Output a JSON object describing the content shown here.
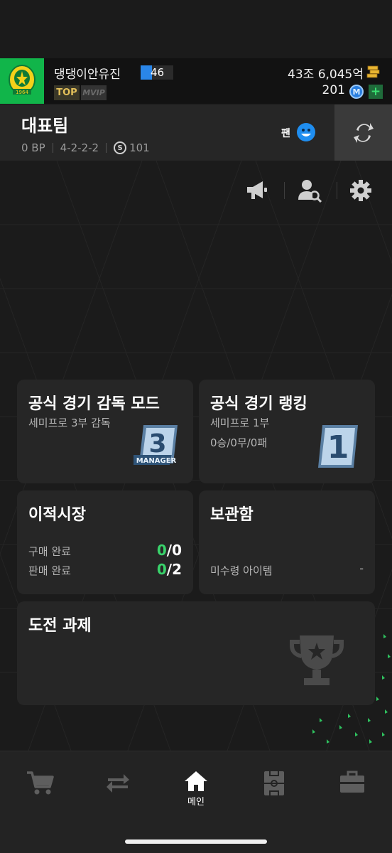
{
  "profile": {
    "nickname": "댕댕이안유진",
    "level": "46",
    "badge_top": "TOP",
    "badge_vip": "MVIP",
    "gold_amount": "43조 6,045억",
    "m_amount": "201",
    "m_icon_letter": "M",
    "plus_label": "+"
  },
  "team": {
    "title": "대표팀",
    "bp": "0 BP",
    "formation": "4-2-2-2",
    "s_icon_letter": "S",
    "score": "101",
    "fan_label": "팬"
  },
  "cards": {
    "manager_mode": {
      "title": "공식 경기 감독 모드",
      "sub": "세미프로 3부 감독"
    },
    "ranking": {
      "title": "공식 경기 랭킹",
      "sub": "세미프로 1부",
      "record": "0승/0무/0패"
    },
    "transfer": {
      "title": "이적시장",
      "buy_label": "구매 완료",
      "buy_done": "0",
      "buy_total": "/0",
      "sell_label": "판매 완료",
      "sell_done": "0",
      "sell_total": "/2"
    },
    "storage": {
      "title": "보관함",
      "unclaimed_label": "미수령 아이템",
      "unclaimed_value": "-"
    },
    "challenge": {
      "title": "도전 과제"
    }
  },
  "nav": {
    "home_label": "메인"
  },
  "colors": {
    "accent_green": "#39d36b",
    "bg": "#1b1b1b",
    "card": "#262626",
    "club_green": "#11b54a"
  },
  "icons": {
    "club": "club-crest-icon",
    "gold": "gold-bars-icon",
    "fan": "smiley-face-icon",
    "swap": "swap-team-icon",
    "announce": "megaphone-icon",
    "search_user": "user-search-icon",
    "settings": "gear-icon",
    "trophy": "trophy-icon",
    "shop": "cart-icon",
    "transfer": "transfer-arrows-icon",
    "home": "home-icon",
    "squad": "pitch-icon",
    "storage": "briefcase-icon"
  }
}
